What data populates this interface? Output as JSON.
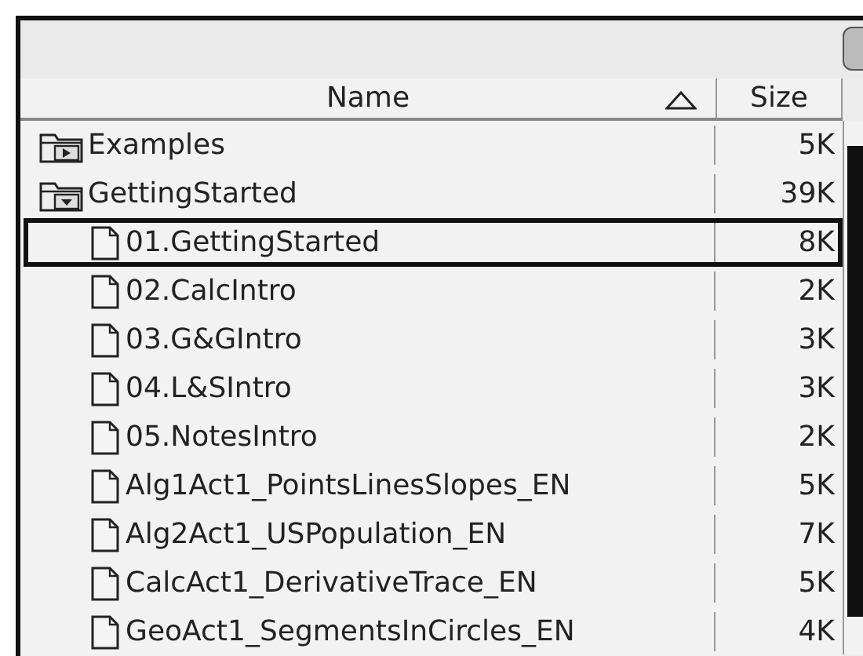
{
  "columns": [
    {
      "label": "Name",
      "sorted": true
    },
    {
      "label": "Size"
    }
  ],
  "items": [
    {
      "kind": "folder",
      "name": "Examples",
      "size": "5K",
      "expanded": false,
      "selected": false
    },
    {
      "kind": "folder",
      "name": "GettingStarted",
      "size": "39K",
      "expanded": true,
      "selected": false,
      "children": [
        {
          "kind": "file",
          "name": "01.GettingStarted",
          "size": "8K",
          "selected": true
        },
        {
          "kind": "file",
          "name": "02.CalcIntro",
          "size": "2K",
          "selected": false
        },
        {
          "kind": "file",
          "name": "03.G&GIntro",
          "size": "3K",
          "selected": false
        },
        {
          "kind": "file",
          "name": "04.L&SIntro",
          "size": "3K",
          "selected": false
        },
        {
          "kind": "file",
          "name": "05.NotesIntro",
          "size": "2K",
          "selected": false
        },
        {
          "kind": "file",
          "name": "Alg1Act1_PointsLinesSlopes_EN",
          "size": "5K",
          "selected": false
        },
        {
          "kind": "file",
          "name": "Alg2Act1_USPopulation_EN",
          "size": "7K",
          "selected": false
        },
        {
          "kind": "file",
          "name": "CalcAct1_DerivativeTrace_EN",
          "size": "5K",
          "selected": false
        },
        {
          "kind": "file",
          "name": "GeoAct1_SegmentsInCircles_EN",
          "size": "4K",
          "selected": false
        }
      ]
    }
  ]
}
